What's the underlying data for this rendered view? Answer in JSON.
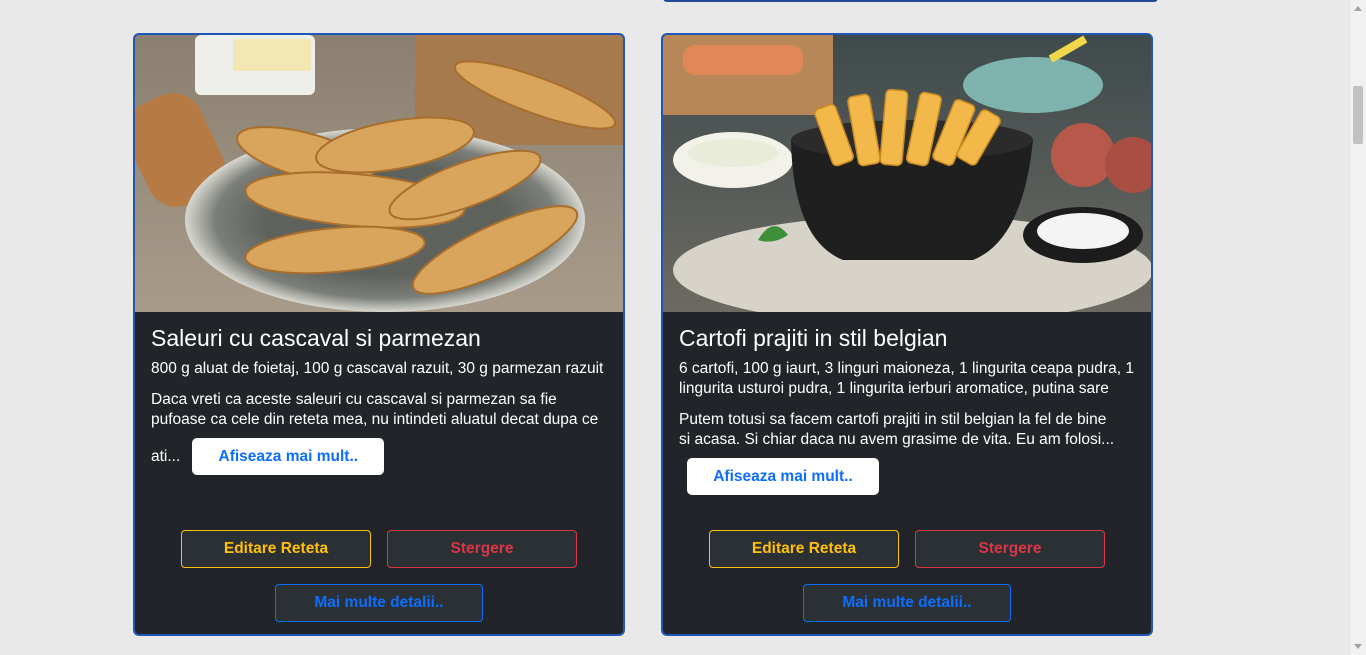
{
  "recipes": [
    {
      "title": "Saleuri cu cascaval si parmezan",
      "ingredients": "800 g aluat de foietaj, 100 g cascaval razuit, 30 g parmezan razuit",
      "description_line1": "Daca vreti ca aceste saleuri cu cascaval si parmezan sa fie",
      "description_line2": "pufoase ca cele din reteta mea, nu intindeti aluatul decat dupa ce",
      "description_tail": "ati...",
      "image_alt": "saleuri cu cascaval si parmezan pe o farfurie",
      "show_more_label": "Afiseaza mai mult..",
      "edit_label": "Editare Reteta",
      "delete_label": "Stergere",
      "details_label": "Mai multe detalii.."
    },
    {
      "title": "Cartofi prajiti in stil belgian",
      "ingredients": "6 cartofi, 100 g iaurt, 3 linguri maioneza, 1 lingurita ceapa pudra, 1 lingurita usturoi pudra, 1 lingurita ierburi aromatice, putina sare",
      "description_line1": "Putem totusi sa facem cartofi prajiti in stil belgian la fel de bine",
      "description_line2": "si acasa. Si chiar daca nu avem grasime de vita. Eu am folosi...",
      "description_tail": "",
      "image_alt": "cartofi prajiti intr-un bol negru",
      "show_more_label": "Afiseaza mai mult..",
      "edit_label": "Editare Reteta",
      "delete_label": "Stergere",
      "details_label": "Mai multe detalii.."
    }
  ],
  "colors": {
    "page_bg": "#e9e9e9",
    "card_bg": "#212529",
    "card_border": "#1f57b8",
    "edit": "#ffc107",
    "delete": "#dc3545",
    "primary": "#0d6efd"
  }
}
